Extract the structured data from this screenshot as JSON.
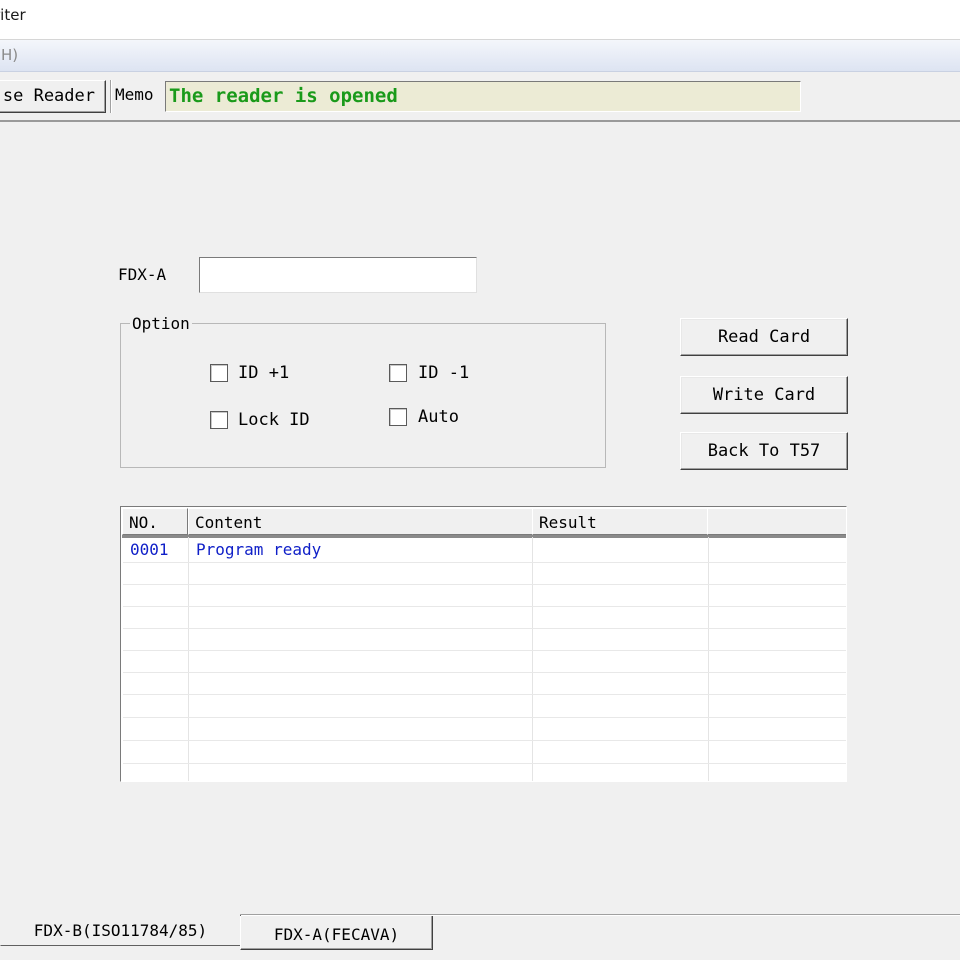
{
  "window": {
    "title": "riter"
  },
  "menu": {
    "help": "o(H)"
  },
  "toolbar": {
    "close_reader_label": "se Reader",
    "memo_label": "Memo",
    "memo_text": "The reader is opened"
  },
  "form": {
    "fdx_label": "FDX-A",
    "fdx_value": "",
    "option_title": "Option",
    "options": {
      "id_plus": "ID +1",
      "id_minus": "ID -1",
      "lock_id": "Lock ID",
      "auto": "Auto"
    }
  },
  "buttons": {
    "read": "Read Card",
    "write": "Write Card",
    "back": "Back To T57"
  },
  "log": {
    "headers": [
      "NO.",
      "Content",
      "Result",
      ""
    ],
    "rows": [
      {
        "no": "0001",
        "content": "Program ready",
        "result": ""
      }
    ]
  },
  "tabs": [
    {
      "label": "FDX-B(ISO11784/85)",
      "active": false
    },
    {
      "label": "FDX-A(FECAVA)",
      "active": true
    }
  ],
  "colors": {
    "memo_text": "#1a9a1a",
    "memo_bg": "#ecebd5",
    "log_text": "#1020c8",
    "window_bg": "#f0f0f0"
  }
}
